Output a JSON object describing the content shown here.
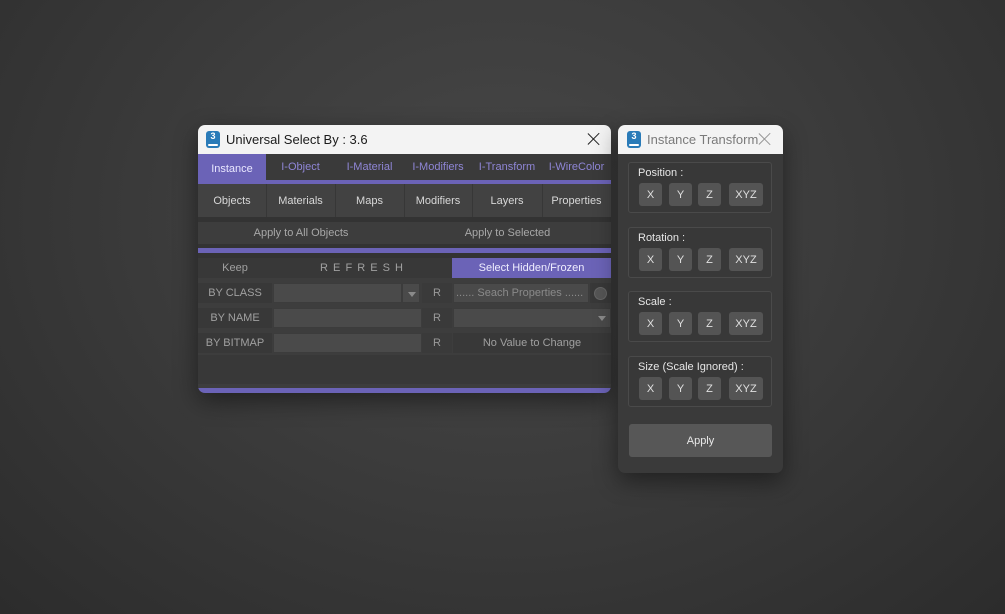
{
  "usb": {
    "icon_glyph": "3",
    "title": "Universal Select By : 3.6",
    "tabs_top": [
      {
        "label": "Instance"
      },
      {
        "label": "I-Object"
      },
      {
        "label": "I-Material"
      },
      {
        "label": "I-Modifiers"
      },
      {
        "label": "I-Transform"
      },
      {
        "label": "I-WireColor"
      }
    ],
    "tabs_bottom": [
      {
        "label": "Objects"
      },
      {
        "label": "Materials"
      },
      {
        "label": "Maps"
      },
      {
        "label": "Modifiers"
      },
      {
        "label": "Layers"
      },
      {
        "label": "Properties"
      }
    ],
    "apply_all": "Apply to All Objects",
    "apply_selected": "Apply to Selected",
    "keep": "Keep",
    "refresh": "R E F R E S H",
    "select_hidden": "Select Hidden/Frozen",
    "by_class": "BY CLASS",
    "by_name": "BY NAME",
    "by_bitmap": "BY BITMAP",
    "r": "R",
    "search_placeholder": "...... Seach Properties ......",
    "no_value": "No Value to Change"
  },
  "itw": {
    "icon_glyph": "3",
    "title": "Instance Transform",
    "groups": [
      {
        "label": "Position :"
      },
      {
        "label": "Rotation :"
      },
      {
        "label": "Scale :"
      },
      {
        "label": "Size (Scale Ignored) :"
      }
    ],
    "axes": {
      "x": "X",
      "y": "Y",
      "z": "Z",
      "xyz": "XYZ"
    },
    "apply": "Apply"
  },
  "colors": {
    "accent": "#6b63b7",
    "panel": "#3d3d3d"
  }
}
